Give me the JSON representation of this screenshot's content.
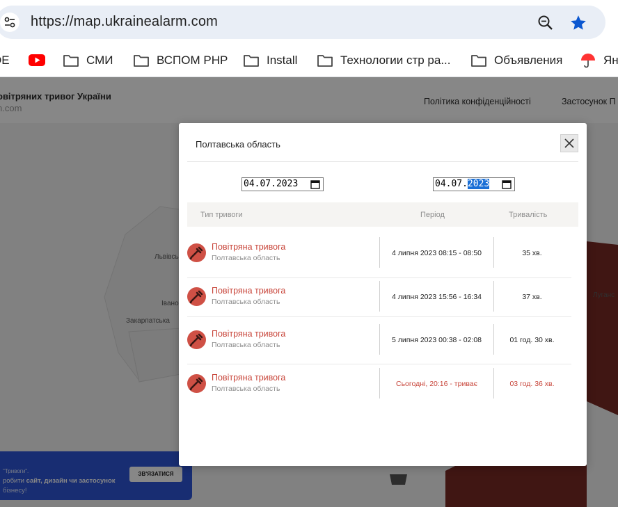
{
  "browser": {
    "url": "https://map.ukrainealarm.com",
    "bookmarks": [
      {
        "label": "DE",
        "icon": "bookmark-icon"
      },
      {
        "label": "",
        "icon": "youtube-icon"
      },
      {
        "label": "СМИ",
        "icon": "folder-icon"
      },
      {
        "label": "ВСПОМ PHP",
        "icon": "folder-icon"
      },
      {
        "label": "Install",
        "icon": "folder-icon"
      },
      {
        "label": "Технологии стр ра...",
        "icon": "folder-icon"
      },
      {
        "label": "Объявления",
        "icon": "folder-icon"
      },
      {
        "label": "Янд",
        "icon": "yandex-icon"
      }
    ]
  },
  "page": {
    "title": "овітряних тривог України",
    "subtitle": "n.com",
    "nav": {
      "privacy": "Політика конфіденційності",
      "app": "Застосунок П"
    },
    "map_labels": {
      "lviv": "Львівсь",
      "ivano": "Івано-",
      "zakarpattia": "Закарпатська",
      "luhansk": "Луганс"
    },
    "promo": {
      "line1": "\"Тривоги\".",
      "line2_prefix": "робити ",
      "line2_bold": "сайт, дизайн чи застосунок",
      "line3": "бізнесу!",
      "button": "ЗВ'ЯЗАТИСЯ"
    }
  },
  "modal": {
    "title": "Полтавська область",
    "date_from": {
      "day": "04",
      "month": "07",
      "year": "2023"
    },
    "date_to": {
      "day": "04",
      "month": "07",
      "year": "2023"
    },
    "columns": {
      "type": "Тип тривоги",
      "period": "Період",
      "duration": "Тривалість"
    },
    "rows": [
      {
        "name": "Повітряна тривога",
        "region": "Полтавська область",
        "period": "4 липня 2023 08:15 - 08:50",
        "duration": "35 хв.",
        "active": false
      },
      {
        "name": "Повітряна тривога",
        "region": "Полтавська область",
        "period": "4 липня 2023 15:56 - 16:34",
        "duration": "37 хв.",
        "active": false
      },
      {
        "name": "Повітряна тривога",
        "region": "Полтавська область",
        "period": "5 липня 2023 00:38 - 02:08",
        "duration": "01 год. 30 хв.",
        "active": false
      },
      {
        "name": "Повітряна тривога",
        "region": "Полтавська область",
        "period": "Сьогодні, 20:16 - триває",
        "duration": "03 год. 36 хв.",
        "active": true
      }
    ]
  },
  "colors": {
    "accent_red": "#c8453a",
    "alert_icon_bg": "#cf5045",
    "selection_blue": "#1a6fd6",
    "map_alert": "#7a2a24"
  }
}
